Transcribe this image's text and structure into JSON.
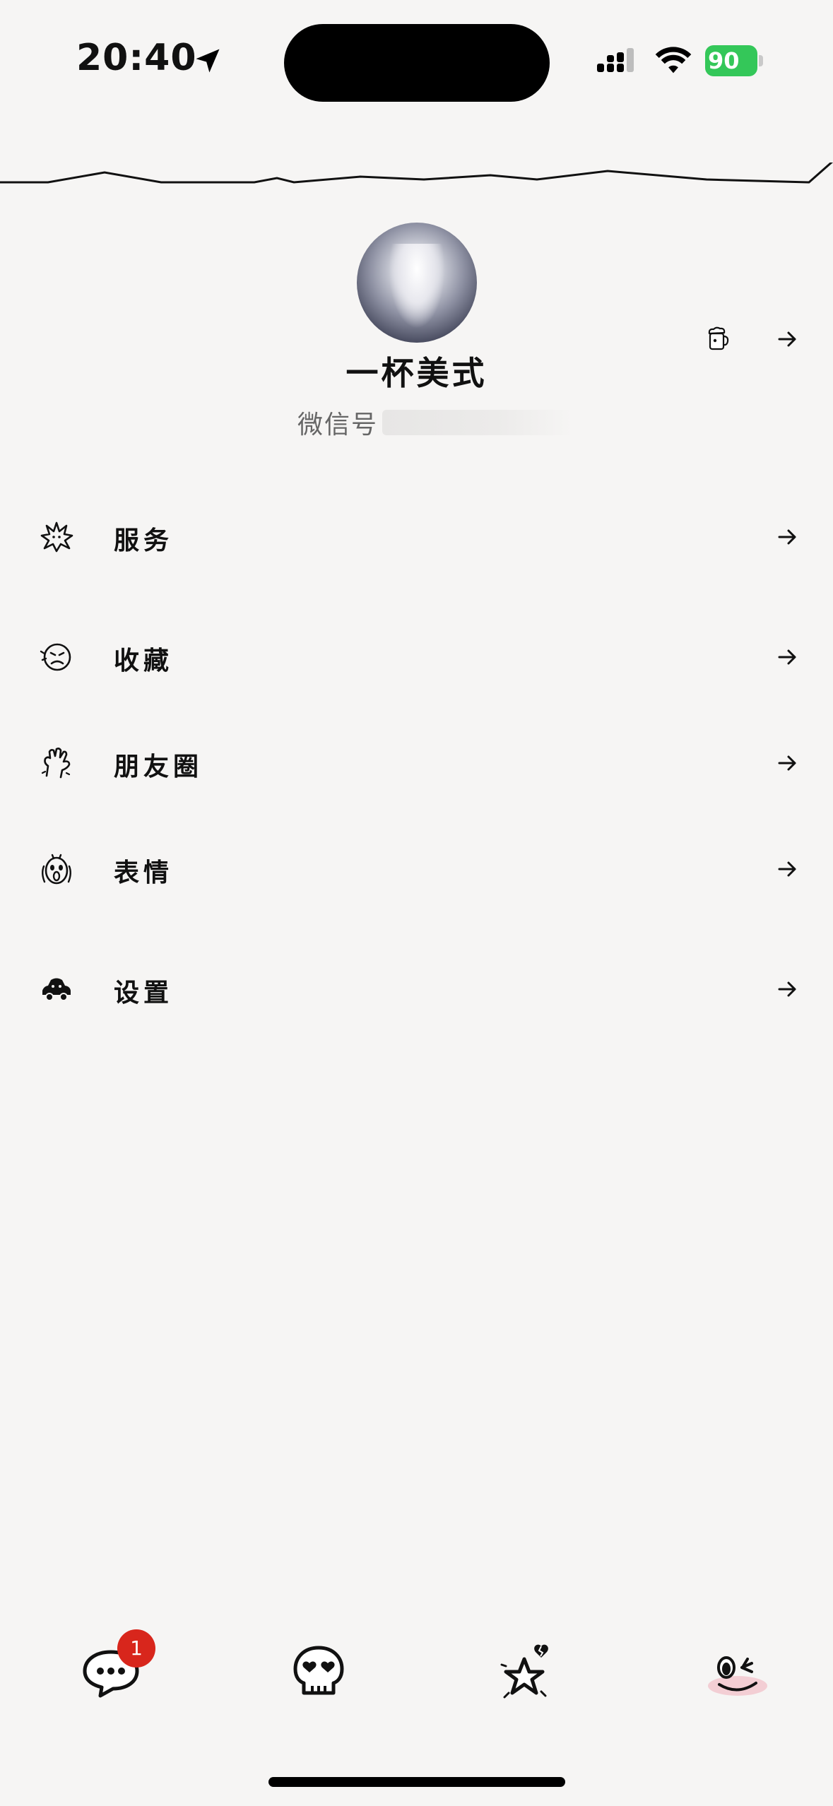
{
  "status_bar": {
    "time": "20:40",
    "battery": "90"
  },
  "profile": {
    "nickname": "一杯美式",
    "wechat_id_label": "微信号"
  },
  "menu": [
    {
      "label": "服务",
      "icon": "sparkle-burst-icon"
    },
    {
      "label": "收藏",
      "icon": "angry-face-icon"
    },
    {
      "label": "朋友圈",
      "icon": "hand-icon"
    },
    {
      "label": "表情",
      "icon": "screaming-face-icon"
    },
    {
      "label": "设置",
      "icon": "car-icon"
    }
  ],
  "tab_bar": {
    "chats_badge": "1",
    "tabs": [
      "chat-bubble-icon",
      "skull-heart-eyes-icon",
      "star-broken-heart-icon",
      "winking-face-icon"
    ]
  },
  "colors": {
    "background": "#f6f5f4",
    "badge": "#d8261c",
    "battery": "#34c759"
  }
}
